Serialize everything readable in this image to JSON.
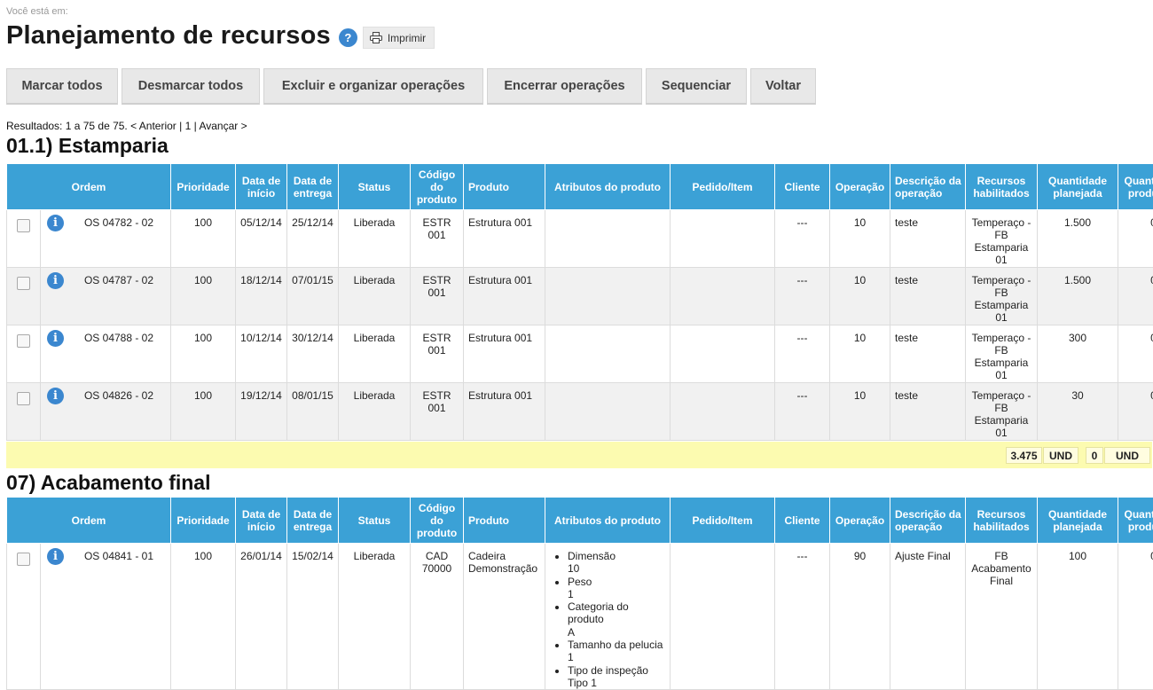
{
  "breadcrumb": "Você está em:",
  "title": "Planejamento de recursos",
  "help_icon_glyph": "?",
  "print_label": "Imprimir",
  "toolbar": [
    {
      "label": "Marcar todos"
    },
    {
      "label": "Desmarcar todos"
    },
    {
      "label": "Excluir e organizar operações"
    },
    {
      "label": "Encerrar operações"
    },
    {
      "label": "Sequenciar"
    },
    {
      "label": "Voltar"
    }
  ],
  "results": {
    "prefix": "Resultados: 1 a 75 de 75.",
    "prev": "< Anterior",
    "sep1": "|",
    "page": "1",
    "sep2": "|",
    "next": "Avançar >"
  },
  "columns": [
    "Ordem",
    "Prioridade",
    "Data de início",
    "Data de entrega",
    "Status",
    "Código do produto",
    "Produto",
    "Atributos do produto",
    "Pedido/Item",
    "Cliente",
    "Operação",
    "Descrição da operação",
    "Recursos habilitados",
    "Quantidade planejada",
    "Quantidade produzida"
  ],
  "sections": [
    {
      "title": "01.1) Estamparia",
      "rows": [
        {
          "ordem": "OS 04782 - 02",
          "prioridade": "100",
          "inicio": "05/12/14",
          "entrega": "25/12/14",
          "status": "Liberada",
          "codigo": "ESTR 001",
          "produto": "Estrutura 001",
          "pedido": "",
          "cliente": "---",
          "operacao": "10",
          "descricao": "teste",
          "recursos": "Temperaço - FB Estamparia 01",
          "planejada": "1.500",
          "produzida": "0"
        },
        {
          "ordem": "OS 04787 - 02",
          "prioridade": "100",
          "inicio": "18/12/14",
          "entrega": "07/01/15",
          "status": "Liberada",
          "codigo": "ESTR 001",
          "produto": "Estrutura 001",
          "pedido": "",
          "cliente": "---",
          "operacao": "10",
          "descricao": "teste",
          "recursos": "Temperaço - FB Estamparia 01",
          "planejada": "1.500",
          "produzida": "0"
        },
        {
          "ordem": "OS 04788 - 02",
          "prioridade": "100",
          "inicio": "10/12/14",
          "entrega": "30/12/14",
          "status": "Liberada",
          "codigo": "ESTR 001",
          "produto": "Estrutura 001",
          "pedido": "",
          "cliente": "---",
          "operacao": "10",
          "descricao": "teste",
          "recursos": "Temperaço - FB Estamparia 01",
          "planejada": "300",
          "produzida": "0"
        },
        {
          "ordem": "OS 04826 - 02",
          "prioridade": "100",
          "inicio": "19/12/14",
          "entrega": "08/01/15",
          "status": "Liberada",
          "codigo": "ESTR 001",
          "produto": "Estrutura 001",
          "pedido": "",
          "cliente": "---",
          "operacao": "10",
          "descricao": "teste",
          "recursos": "Temperaço - FB Estamparia 01",
          "planejada": "30",
          "produzida": "0"
        }
      ],
      "totals": {
        "planejada_value": "3.475",
        "planejada_unit": "UND",
        "produzida_value": "0",
        "produzida_unit": "UND"
      }
    },
    {
      "title": "07) Acabamento final",
      "rows": [
        {
          "ordem": "OS 04841 - 01",
          "prioridade": "100",
          "inicio": "26/01/14",
          "entrega": "15/02/14",
          "status": "Liberada",
          "codigo": "CAD 70000",
          "produto": "Cadeira Demonstração",
          "pedido": "",
          "cliente": "---",
          "operacao": "90",
          "descricao": "Ajuste Final",
          "recursos": "FB Acabamento Final",
          "planejada": "100",
          "produzida": "0",
          "atributos": [
            {
              "name": "Dimensão",
              "value": "10"
            },
            {
              "name": "Peso",
              "value": "1"
            },
            {
              "name": "Categoria do produto",
              "value": "A"
            },
            {
              "name": "Tamanho da pelucia",
              "value": "1"
            },
            {
              "name": "Tipo de inspeção",
              "value": "Tipo 1"
            }
          ]
        }
      ]
    }
  ],
  "info_icon_glyph": "i",
  "colors": {
    "header": "#3ba1d6",
    "totals_bg": "#fcfbb0",
    "icon_blue": "#3b87cf",
    "button_bg": "#e8e8e8"
  }
}
